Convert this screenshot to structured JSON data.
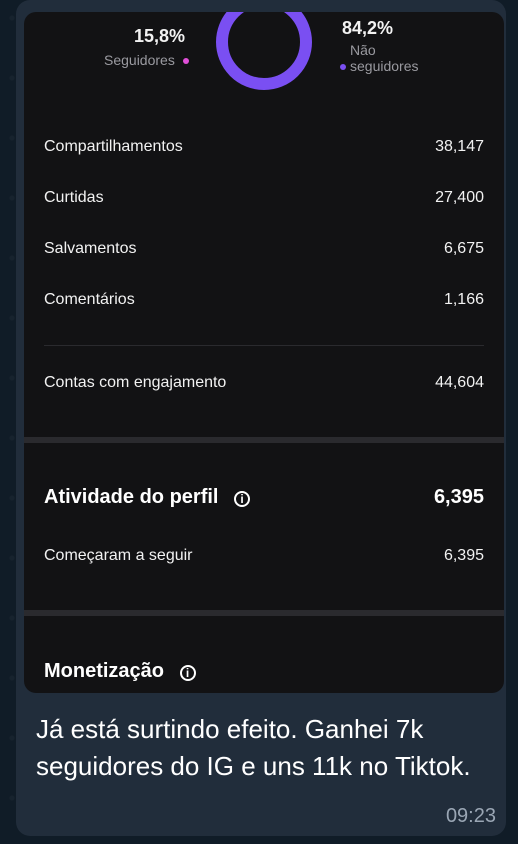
{
  "donut": {
    "followers": {
      "pct": "15,8%",
      "label": "Seguidores",
      "value": 15.8,
      "color": "#e04fd8"
    },
    "non_followers": {
      "pct": "84,2%",
      "label_line1": "Não",
      "label_line2": "seguidores",
      "value": 84.2,
      "color": "#7a4ff2"
    }
  },
  "metrics": [
    {
      "label": "Compartilhamentos",
      "value": "38,147"
    },
    {
      "label": "Curtidas",
      "value": "27,400"
    },
    {
      "label": "Salvamentos",
      "value": "6,675"
    },
    {
      "label": "Comentários",
      "value": "1,166"
    }
  ],
  "engaged": {
    "label": "Contas com engajamento",
    "value": "44,604"
  },
  "profile_activity": {
    "title": "Atividade do perfil",
    "value": "6,395",
    "row": {
      "label": "Começaram a seguir",
      "value": "6,395"
    }
  },
  "monetization": {
    "title": "Monetização"
  },
  "message": {
    "text": "Já está surtindo efeito. Ganhei 7k seguidores do IG e uns 11k no Tiktok.",
    "time": "09:23"
  },
  "colors": {
    "bubble": "#212d3b",
    "card": "#121214",
    "follower_dot": "#e04fd8",
    "nonfollower_dot": "#7a4ff2"
  }
}
